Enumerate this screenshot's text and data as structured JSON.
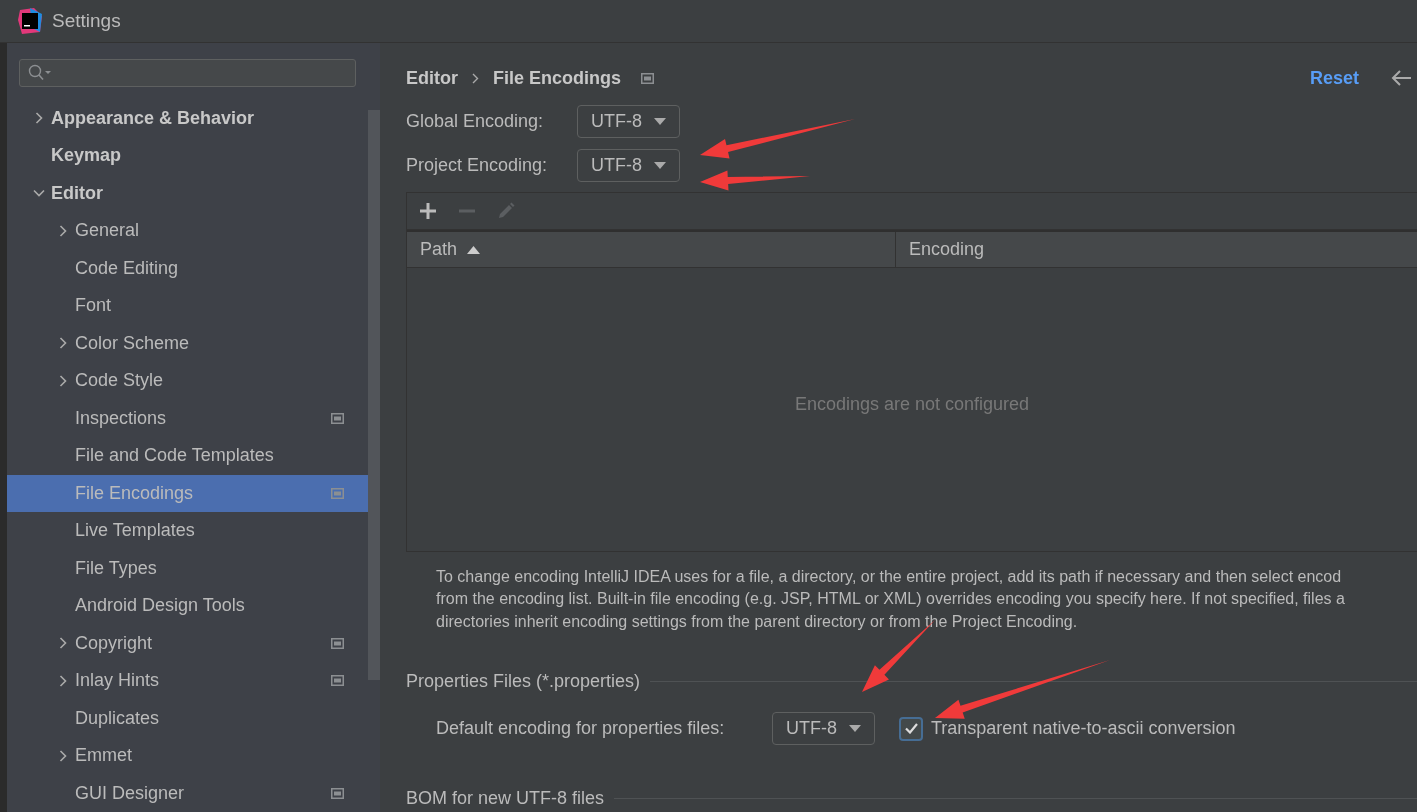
{
  "window": {
    "title": "Settings"
  },
  "sidebar": {
    "items": [
      {
        "label": "Appearance & Behavior",
        "expanded": false,
        "selected": false,
        "page_icon": false
      },
      {
        "label": "Keymap",
        "selected": false,
        "page_icon": false
      },
      {
        "label": "Editor",
        "expanded": true,
        "selected": false,
        "page_icon": false,
        "children": [
          {
            "label": "General",
            "expanded": false,
            "selected": false,
            "page_icon": false
          },
          {
            "label": "Code Editing",
            "selected": false,
            "page_icon": false
          },
          {
            "label": "Font",
            "selected": false,
            "page_icon": false
          },
          {
            "label": "Color Scheme",
            "expanded": false,
            "selected": false,
            "page_icon": false
          },
          {
            "label": "Code Style",
            "expanded": false,
            "selected": false,
            "page_icon": false
          },
          {
            "label": "Inspections",
            "selected": false,
            "page_icon": true
          },
          {
            "label": "File and Code Templates",
            "selected": false,
            "page_icon": false
          },
          {
            "label": "File Encodings",
            "selected": true,
            "page_icon": true
          },
          {
            "label": "Live Templates",
            "selected": false,
            "page_icon": false
          },
          {
            "label": "File Types",
            "selected": false,
            "page_icon": false
          },
          {
            "label": "Android Design Tools",
            "selected": false,
            "page_icon": false
          },
          {
            "label": "Copyright",
            "expanded": false,
            "selected": false,
            "page_icon": true
          },
          {
            "label": "Inlay Hints",
            "expanded": false,
            "selected": false,
            "page_icon": true
          },
          {
            "label": "Duplicates",
            "selected": false,
            "page_icon": false
          },
          {
            "label": "Emmet",
            "expanded": false,
            "selected": false,
            "page_icon": false
          },
          {
            "label": "GUI Designer",
            "selected": false,
            "page_icon": true
          }
        ]
      }
    ]
  },
  "breadcrumb": [
    "Editor",
    "File Encodings"
  ],
  "reset": "Reset",
  "encodings": [
    {
      "label": "Global Encoding:",
      "value": "UTF-8"
    },
    {
      "label": "Project Encoding:",
      "value": "UTF-8"
    }
  ],
  "table": {
    "toolbar": [
      {
        "kind": "add",
        "disabled": false
      },
      {
        "kind": "remove",
        "disabled": true
      },
      {
        "kind": "edit",
        "disabled": true
      }
    ],
    "columns": [
      {
        "label": "Path",
        "sorted_ascending": true
      },
      {
        "label": "Encoding"
      }
    ],
    "empty_text": "Encodings are not configured"
  },
  "description": [
    "To change encoding IntelliJ IDEA uses for a file, a directory, or the entire project, add its path if necessary and then select encod",
    "from the encoding list. Built-in file encoding (e.g. JSP, HTML or XML) overrides encoding you specify here. If not specified, files a",
    "directories inherit encoding settings from the parent directory or from the Project Encoding."
  ],
  "properties": {
    "title": "Properties Files (*.properties)",
    "label": "Default encoding for properties files:",
    "value": "UTF-8",
    "checkbox": {
      "label": "Transparent native-to-ascii conversion",
      "checked": true
    }
  },
  "bom": {
    "title": "BOM for new UTF-8 files"
  }
}
